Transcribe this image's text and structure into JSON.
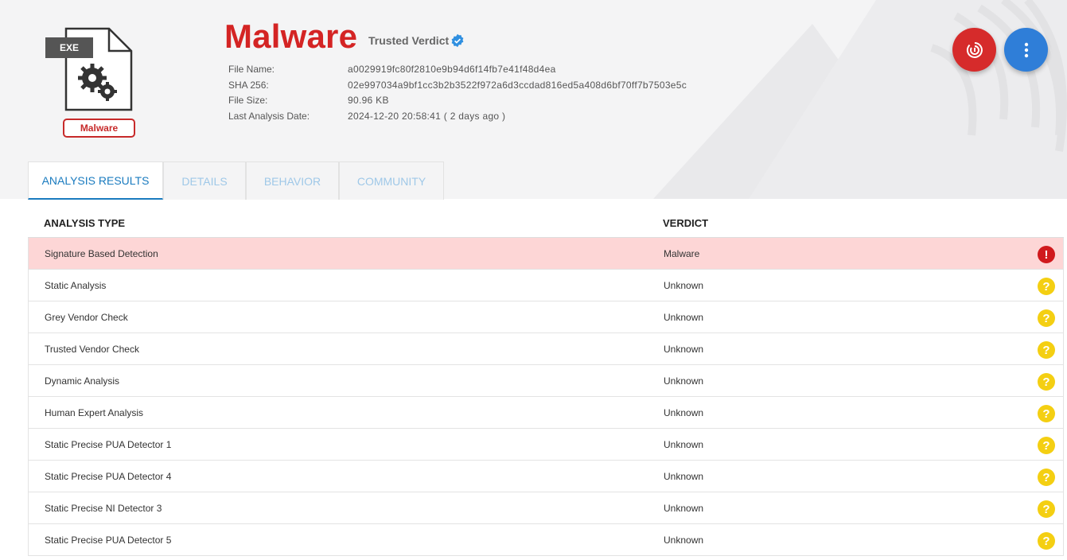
{
  "file": {
    "ext_label": "EXE",
    "badge": "Malware"
  },
  "verdict": {
    "title": "Malware",
    "trusted_label": "Trusted Verdict"
  },
  "meta": [
    {
      "key": "File Name:",
      "value": "a0029919fc80f2810e9b94d6f14fb7e41f48d4ea"
    },
    {
      "key": "SHA 256:",
      "value": "02e997034a9bf1cc3b2b3522f972a6d3ccdad816ed5a408d6bf70ff7b7503e5c"
    },
    {
      "key": "File Size:",
      "value": "90.96 KB"
    },
    {
      "key": "Last Analysis Date:",
      "value": "2024-12-20 20:58:41 ( 2 days ago )"
    }
  ],
  "actions": {
    "scan_icon": "fingerprint-power-icon",
    "menu_icon": "more-vertical-icon"
  },
  "tabs": [
    {
      "label": "ANALYSIS RESULTS",
      "active": true
    },
    {
      "label": "DETAILS",
      "active": false
    },
    {
      "label": "BEHAVIOR",
      "active": false
    },
    {
      "label": "COMMUNITY",
      "active": false
    }
  ],
  "table": {
    "headers": [
      "ANALYSIS TYPE",
      "VERDICT"
    ],
    "rows": [
      {
        "type": "Signature Based Detection",
        "verdict": "Malware",
        "status": "error"
      },
      {
        "type": "Static Analysis",
        "verdict": "Unknown",
        "status": "unknown"
      },
      {
        "type": "Grey Vendor Check",
        "verdict": "Unknown",
        "status": "unknown"
      },
      {
        "type": "Trusted Vendor Check",
        "verdict": "Unknown",
        "status": "unknown"
      },
      {
        "type": "Dynamic Analysis",
        "verdict": "Unknown",
        "status": "unknown"
      },
      {
        "type": "Human Expert Analysis",
        "verdict": "Unknown",
        "status": "unknown"
      },
      {
        "type": "Static Precise PUA Detector 1",
        "verdict": "Unknown",
        "status": "unknown"
      },
      {
        "type": "Static Precise PUA Detector 4",
        "verdict": "Unknown",
        "status": "unknown"
      },
      {
        "type": "Static Precise NI Detector 3",
        "verdict": "Unknown",
        "status": "unknown"
      },
      {
        "type": "Static Precise PUA Detector 5",
        "verdict": "Unknown",
        "status": "unknown"
      }
    ]
  },
  "colors": {
    "malware_red": "#d42424",
    "accent_blue": "#1a7bbf",
    "error_red": "#d0191d",
    "unknown_yellow": "#f4cf12",
    "bad_row_bg": "#fdd6d6"
  }
}
